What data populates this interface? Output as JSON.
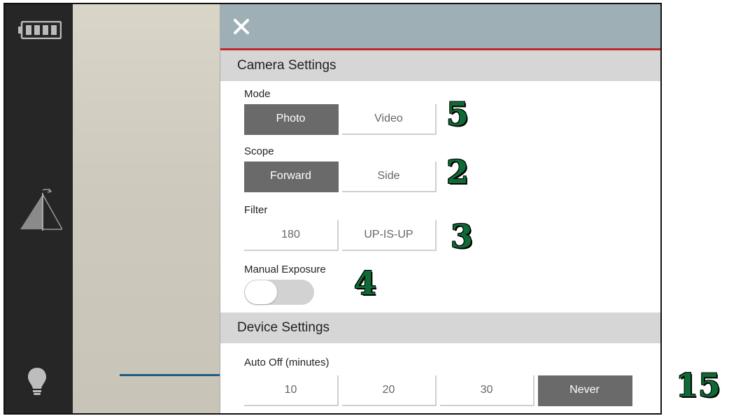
{
  "sidebar": {
    "battery_icon": "battery-full-icon",
    "scope_icon": "prism-rotate-icon",
    "light_icon": "lightbulb-icon"
  },
  "panel": {
    "close_icon": "close-icon",
    "accent_color": "#c1272d",
    "camera_settings": {
      "title": "Camera Settings",
      "mode": {
        "label": "Mode",
        "options": [
          "Photo",
          "Video"
        ],
        "selected": "Photo"
      },
      "scope": {
        "label": "Scope",
        "options": [
          "Forward",
          "Side"
        ],
        "selected": "Forward"
      },
      "filter": {
        "label": "Filter",
        "options": [
          "180",
          "UP-IS-UP"
        ],
        "selected": null
      },
      "manual_exposure": {
        "label": "Manual Exposure",
        "enabled": false
      }
    },
    "device_settings": {
      "title": "Device Settings",
      "auto_off": {
        "label": "Auto Off (minutes)",
        "options": [
          "10",
          "20",
          "30",
          "Never"
        ],
        "selected": "Never"
      }
    }
  },
  "annotations": {
    "mode": "5",
    "scope": "2",
    "filter": "3",
    "exposure": "4",
    "auto_off": "15"
  }
}
